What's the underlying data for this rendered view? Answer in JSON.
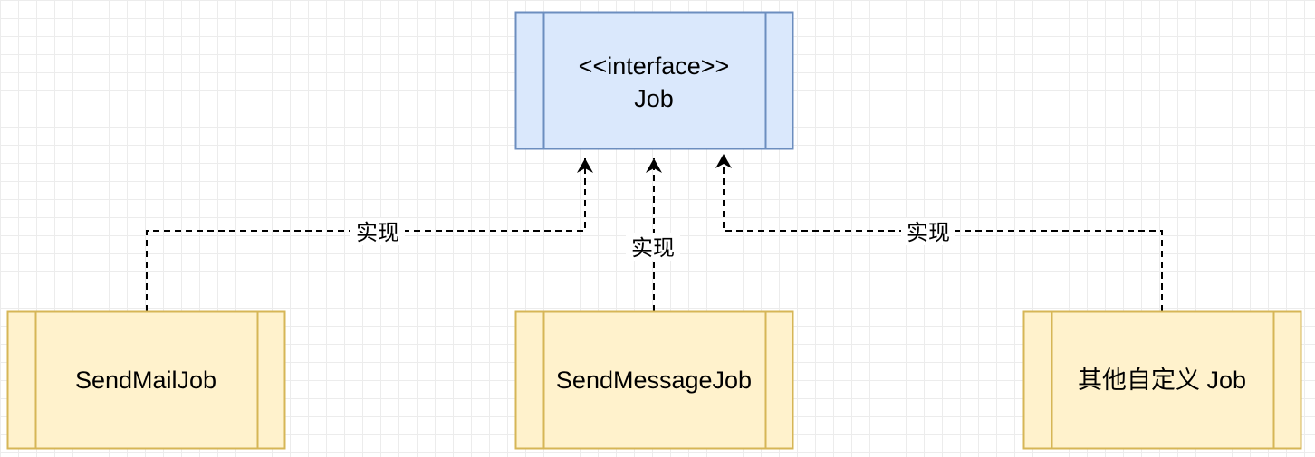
{
  "diagram": {
    "interface_node": {
      "stereotype": "<<interface>>",
      "name": "Job",
      "fill": "#dae8fc",
      "stroke": "#6c8ebf"
    },
    "implementations": [
      {
        "name": "SendMailJob",
        "fill": "#fff2cc",
        "stroke": "#d6b656"
      },
      {
        "name": "SendMessageJob",
        "fill": "#fff2cc",
        "stroke": "#d6b656"
      },
      {
        "name": "其他自定义 Job",
        "fill": "#fff2cc",
        "stroke": "#d6b656"
      }
    ],
    "edges": [
      {
        "from": "SendMailJob",
        "to": "Job",
        "label": "实现",
        "style": "dashed"
      },
      {
        "from": "SendMessageJob",
        "to": "Job",
        "label": "实现",
        "style": "dashed"
      },
      {
        "from": "其他自定义 Job",
        "to": "Job",
        "label": "实现",
        "style": "dashed"
      }
    ]
  }
}
